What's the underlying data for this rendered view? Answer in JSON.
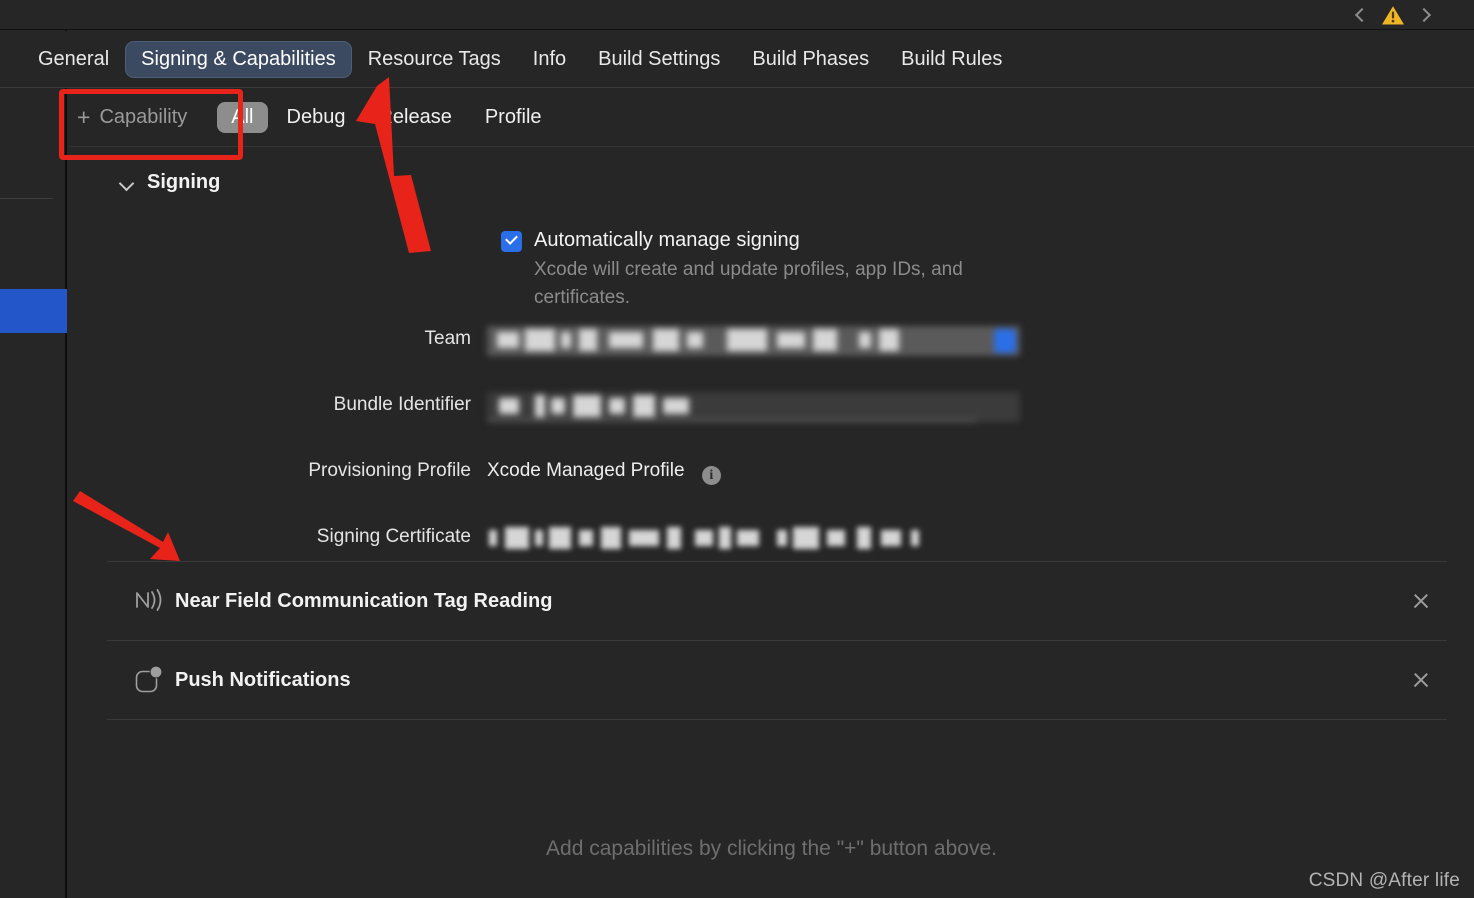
{
  "window": {
    "background_color": "#262626",
    "accent_blue": "#2357c9",
    "annotation_color": "#e8241a"
  },
  "topstrip": {
    "back_icon": "chevron-left-icon",
    "warning_icon": "warning-triangle-icon",
    "warning_color": "#eeb527",
    "forward_icon": "chevron-right-icon"
  },
  "tabs": [
    {
      "label": "General",
      "active": false
    },
    {
      "label": "Signing & Capabilities",
      "active": true
    },
    {
      "label": "Resource Tags",
      "active": false
    },
    {
      "label": "Info",
      "active": false
    },
    {
      "label": "Build Settings",
      "active": false
    },
    {
      "label": "Build Phases",
      "active": false
    },
    {
      "label": "Build Rules",
      "active": false
    }
  ],
  "toolbar": {
    "add_capability_label": "Capability",
    "add_capability_plus": "+",
    "filters": [
      {
        "label": "All",
        "active": true
      },
      {
        "label": "Debug",
        "active": false
      },
      {
        "label": "Release",
        "active": false
      },
      {
        "label": "Profile",
        "active": false
      }
    ]
  },
  "signing": {
    "section_title": "Signing",
    "disclosure_icon": "chevron-down-icon",
    "automatically_manage": {
      "label": "Automatically manage signing",
      "checked": true,
      "description": "Xcode will create and update profiles, app IDs, and certificates."
    },
    "rows": [
      {
        "label": "Team",
        "value": "",
        "redacted": true
      },
      {
        "label": "Bundle Identifier",
        "value": "",
        "redacted": true
      },
      {
        "label": "Provisioning Profile",
        "value": "Xcode Managed Profile",
        "redacted": false,
        "info_icon": "info-circle-icon"
      },
      {
        "label": "Signing Certificate",
        "value": "",
        "redacted": true
      }
    ]
  },
  "capabilities": [
    {
      "name": "Near Field Communication Tag Reading",
      "icon": "nfc-icon",
      "remove_icon": "close-icon"
    },
    {
      "name": "Push Notifications",
      "icon": "push-notification-badge-icon",
      "remove_icon": "close-icon"
    }
  ],
  "empty_hint": "Add capabilities by clicking the \"+\" button above.",
  "watermark": "CSDN @After life"
}
